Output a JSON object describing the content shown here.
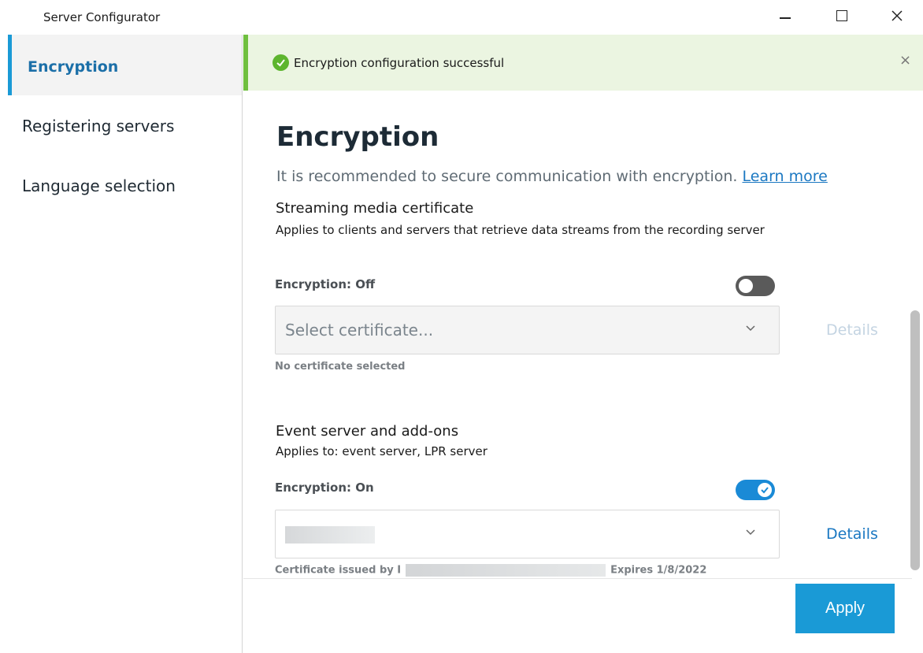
{
  "window": {
    "title": "Server Configurator",
    "minimize_icon": "minimize-icon",
    "maximize_icon": "maximize-icon",
    "close_icon": "close-icon"
  },
  "sidebar": {
    "items": [
      {
        "label": "Encryption",
        "active": true
      },
      {
        "label": "Registering servers",
        "active": false
      },
      {
        "label": "Language selection",
        "active": false
      }
    ],
    "accent_color": "#1a9ad6"
  },
  "banner": {
    "message": "Encryption configuration successful",
    "status_color": "#5db52e",
    "background": "#ebf5e1",
    "close_symbol": "×"
  },
  "page": {
    "title": "Encryption",
    "intro": "It is recommended to secure communication with encryption.",
    "learn_more": "Learn more"
  },
  "streaming": {
    "title": "Streaming media certificate",
    "description": "Applies to clients and servers that retrieve data streams from the recording server",
    "encryption_label": "Encryption: Off",
    "enabled": false,
    "select_placeholder": "Select certificate...",
    "details_label": "Details",
    "hint": "No certificate selected"
  },
  "event_server": {
    "title": "Event server and add-ons",
    "description": "Applies to: event server, LPR server",
    "encryption_label": "Encryption: On",
    "enabled": true,
    "details_label": "Details",
    "hint_prefix": "Certificate issued by I",
    "hint_suffix": "Expires 1/8/2022"
  },
  "footer": {
    "apply_label": "Apply",
    "accent_color": "#1a9ad6"
  }
}
